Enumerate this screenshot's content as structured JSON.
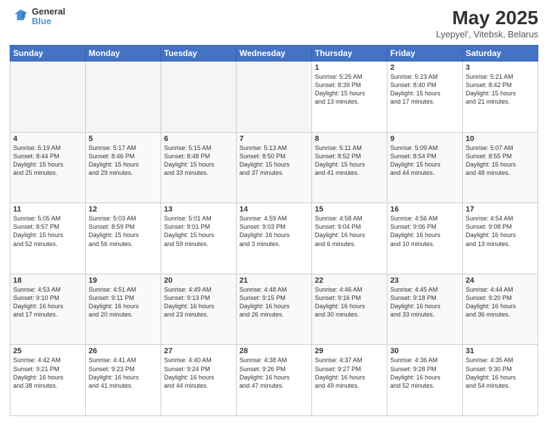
{
  "header": {
    "logo_line1": "General",
    "logo_line2": "Blue",
    "title": "May 2025",
    "subtitle": "Lyepyel', Vitebsk, Belarus"
  },
  "days_of_week": [
    "Sunday",
    "Monday",
    "Tuesday",
    "Wednesday",
    "Thursday",
    "Friday",
    "Saturday"
  ],
  "weeks": [
    [
      {
        "num": "",
        "info": "",
        "empty": true
      },
      {
        "num": "",
        "info": "",
        "empty": true
      },
      {
        "num": "",
        "info": "",
        "empty": true
      },
      {
        "num": "",
        "info": "",
        "empty": true
      },
      {
        "num": "1",
        "info": "Sunrise: 5:25 AM\nSunset: 8:39 PM\nDaylight: 15 hours\nand 13 minutes."
      },
      {
        "num": "2",
        "info": "Sunrise: 5:23 AM\nSunset: 8:40 PM\nDaylight: 15 hours\nand 17 minutes."
      },
      {
        "num": "3",
        "info": "Sunrise: 5:21 AM\nSunset: 8:42 PM\nDaylight: 15 hours\nand 21 minutes."
      }
    ],
    [
      {
        "num": "4",
        "info": "Sunrise: 5:19 AM\nSunset: 8:44 PM\nDaylight: 15 hours\nand 25 minutes."
      },
      {
        "num": "5",
        "info": "Sunrise: 5:17 AM\nSunset: 8:46 PM\nDaylight: 15 hours\nand 29 minutes."
      },
      {
        "num": "6",
        "info": "Sunrise: 5:15 AM\nSunset: 8:48 PM\nDaylight: 15 hours\nand 33 minutes."
      },
      {
        "num": "7",
        "info": "Sunrise: 5:13 AM\nSunset: 8:50 PM\nDaylight: 15 hours\nand 37 minutes."
      },
      {
        "num": "8",
        "info": "Sunrise: 5:11 AM\nSunset: 8:52 PM\nDaylight: 15 hours\nand 41 minutes."
      },
      {
        "num": "9",
        "info": "Sunrise: 5:09 AM\nSunset: 8:54 PM\nDaylight: 15 hours\nand 44 minutes."
      },
      {
        "num": "10",
        "info": "Sunrise: 5:07 AM\nSunset: 8:55 PM\nDaylight: 15 hours\nand 48 minutes."
      }
    ],
    [
      {
        "num": "11",
        "info": "Sunrise: 5:05 AM\nSunset: 8:57 PM\nDaylight: 15 hours\nand 52 minutes."
      },
      {
        "num": "12",
        "info": "Sunrise: 5:03 AM\nSunset: 8:59 PM\nDaylight: 15 hours\nand 56 minutes."
      },
      {
        "num": "13",
        "info": "Sunrise: 5:01 AM\nSunset: 9:01 PM\nDaylight: 15 hours\nand 59 minutes."
      },
      {
        "num": "14",
        "info": "Sunrise: 4:59 AM\nSunset: 9:03 PM\nDaylight: 16 hours\nand 3 minutes."
      },
      {
        "num": "15",
        "info": "Sunrise: 4:58 AM\nSunset: 9:04 PM\nDaylight: 16 hours\nand 6 minutes."
      },
      {
        "num": "16",
        "info": "Sunrise: 4:56 AM\nSunset: 9:06 PM\nDaylight: 16 hours\nand 10 minutes."
      },
      {
        "num": "17",
        "info": "Sunrise: 4:54 AM\nSunset: 9:08 PM\nDaylight: 16 hours\nand 13 minutes."
      }
    ],
    [
      {
        "num": "18",
        "info": "Sunrise: 4:53 AM\nSunset: 9:10 PM\nDaylight: 16 hours\nand 17 minutes."
      },
      {
        "num": "19",
        "info": "Sunrise: 4:51 AM\nSunset: 9:11 PM\nDaylight: 16 hours\nand 20 minutes."
      },
      {
        "num": "20",
        "info": "Sunrise: 4:49 AM\nSunset: 9:13 PM\nDaylight: 16 hours\nand 23 minutes."
      },
      {
        "num": "21",
        "info": "Sunrise: 4:48 AM\nSunset: 9:15 PM\nDaylight: 16 hours\nand 26 minutes."
      },
      {
        "num": "22",
        "info": "Sunrise: 4:46 AM\nSunset: 9:16 PM\nDaylight: 16 hours\nand 30 minutes."
      },
      {
        "num": "23",
        "info": "Sunrise: 4:45 AM\nSunset: 9:18 PM\nDaylight: 16 hours\nand 33 minutes."
      },
      {
        "num": "24",
        "info": "Sunrise: 4:44 AM\nSunset: 9:20 PM\nDaylight: 16 hours\nand 36 minutes."
      }
    ],
    [
      {
        "num": "25",
        "info": "Sunrise: 4:42 AM\nSunset: 9:21 PM\nDaylight: 16 hours\nand 38 minutes."
      },
      {
        "num": "26",
        "info": "Sunrise: 4:41 AM\nSunset: 9:23 PM\nDaylight: 16 hours\nand 41 minutes."
      },
      {
        "num": "27",
        "info": "Sunrise: 4:40 AM\nSunset: 9:24 PM\nDaylight: 16 hours\nand 44 minutes."
      },
      {
        "num": "28",
        "info": "Sunrise: 4:38 AM\nSunset: 9:26 PM\nDaylight: 16 hours\nand 47 minutes."
      },
      {
        "num": "29",
        "info": "Sunrise: 4:37 AM\nSunset: 9:27 PM\nDaylight: 16 hours\nand 49 minutes."
      },
      {
        "num": "30",
        "info": "Sunrise: 4:36 AM\nSunset: 9:28 PM\nDaylight: 16 hours\nand 52 minutes."
      },
      {
        "num": "31",
        "info": "Sunrise: 4:35 AM\nSunset: 9:30 PM\nDaylight: 16 hours\nand 54 minutes."
      }
    ]
  ]
}
